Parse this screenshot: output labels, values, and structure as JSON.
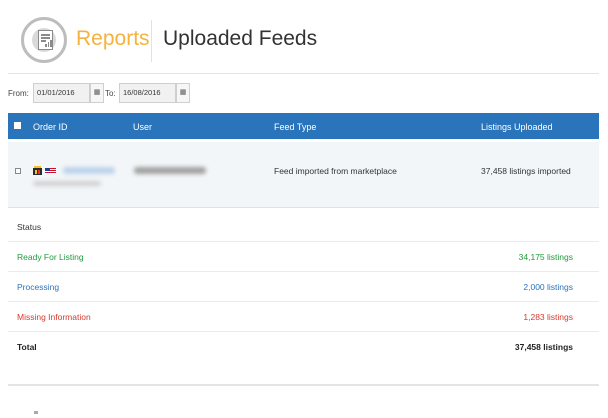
{
  "header": {
    "section": "Reports",
    "title": "Uploaded Feeds",
    "icon": "report-document-icon"
  },
  "filters": {
    "from_label": "From:",
    "from_value": "01/01/2016",
    "to_label": "To:",
    "to_value": "16/08/2016",
    "calendar_icon": "calendar-icon"
  },
  "table": {
    "columns": {
      "order_id": "Order ID",
      "user": "User",
      "feed_type": "Feed Type",
      "listings": "Listings Uploaded"
    },
    "rows": [
      {
        "feed_type": "Feed imported from marketplace",
        "listings": "37,458 listings imported"
      }
    ]
  },
  "status": {
    "heading": "Status",
    "items": [
      {
        "label": "Ready For Listing",
        "value": "34,175 listings",
        "color": "#1e9b3c"
      },
      {
        "label": "Processing",
        "value": "2,000 listings",
        "color": "#2a74bb"
      },
      {
        "label": "Missing Information",
        "value": "1,283 listings",
        "color": "#d63a2f"
      },
      {
        "label": "Total",
        "value": "37,458 listings",
        "color": "#222222"
      }
    ]
  }
}
